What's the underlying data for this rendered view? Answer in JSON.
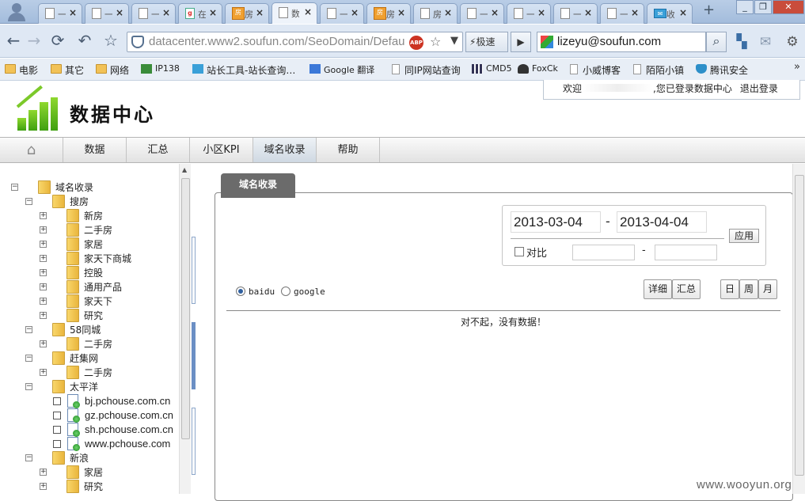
{
  "browser": {
    "tabs": [
      {
        "title": "一"
      },
      {
        "title": "一"
      },
      {
        "title": "一"
      },
      {
        "title": "在"
      },
      {
        "title": "房"
      },
      {
        "title": "数"
      },
      {
        "title": "一"
      },
      {
        "title": "房"
      },
      {
        "title": "房"
      },
      {
        "title": "一"
      },
      {
        "title": "一"
      },
      {
        "title": "一"
      },
      {
        "title": "一"
      },
      {
        "title": "收"
      }
    ],
    "address": "datacenter.www2.soufun.com/SeoDomain/Defaul",
    "speed_label": "极速",
    "search_value": "lizeyu@soufun.com"
  },
  "bookmarks": [
    "电影",
    "其它",
    "网络",
    "IP138",
    "站长工具-站长查询…",
    "Google 翻译",
    "同IP网站查询",
    "CMD5",
    "FoxCk",
    "小威博客",
    "陌陌小镇",
    "腾讯安全"
  ],
  "header": {
    "brand": "数据中心",
    "welcome_prefix": "欢迎",
    "welcome_suffix": ",您已登录数据中心",
    "logout": "退出登录"
  },
  "nav": [
    "数据",
    "汇总",
    "小区KPI",
    "域名收录",
    "帮助"
  ],
  "tree": [
    {
      "label": "域名收录",
      "kind": "folder",
      "expander": "−"
    },
    {
      "label": "搜房",
      "kind": "folder",
      "expander": "−"
    },
    {
      "label": "新房",
      "kind": "folder",
      "expander": "+"
    },
    {
      "label": "二手房",
      "kind": "folder",
      "expander": "+"
    },
    {
      "label": "家居",
      "kind": "folder",
      "expander": "+"
    },
    {
      "label": "家天下商城",
      "kind": "folder",
      "expander": "+"
    },
    {
      "label": "控股",
      "kind": "folder",
      "expander": "+"
    },
    {
      "label": "通用产品",
      "kind": "folder",
      "expander": "+"
    },
    {
      "label": "家天下",
      "kind": "folder",
      "expander": "+"
    },
    {
      "label": "研究",
      "kind": "folder",
      "expander": "+"
    },
    {
      "label": "58同城",
      "kind": "folder",
      "expander": "−"
    },
    {
      "label": "二手房",
      "kind": "folder",
      "expander": "+"
    },
    {
      "label": "赶集网",
      "kind": "folder",
      "expander": "−"
    },
    {
      "label": "二手房",
      "kind": "folder",
      "expander": "+"
    },
    {
      "label": "太平洋",
      "kind": "folder",
      "expander": "−"
    },
    {
      "label": "bj.pchouse.com.cn",
      "kind": "page"
    },
    {
      "label": "gz.pchouse.com.cn",
      "kind": "page"
    },
    {
      "label": "sh.pchouse.com.cn",
      "kind": "page"
    },
    {
      "label": "www.pchouse.com",
      "kind": "page"
    },
    {
      "label": "新浪",
      "kind": "folder",
      "expander": "−"
    },
    {
      "label": "家居",
      "kind": "folder",
      "expander": "+"
    },
    {
      "label": "研究",
      "kind": "folder",
      "expander": "+"
    }
  ],
  "main": {
    "panel_tab": "域名收录",
    "date_from": "2013-03-04",
    "date_to": "2013-04-04",
    "date_sep": "-",
    "apply_label": "应用",
    "compare_label": "对比",
    "compare_sep": "-",
    "engines": [
      "baidu",
      "google"
    ],
    "detail_label": "详细",
    "summary_label": "汇总",
    "period": [
      "日",
      "周",
      "月"
    ],
    "no_data": "对不起，没有数据！"
  },
  "watermark": "www.wooyun.org"
}
